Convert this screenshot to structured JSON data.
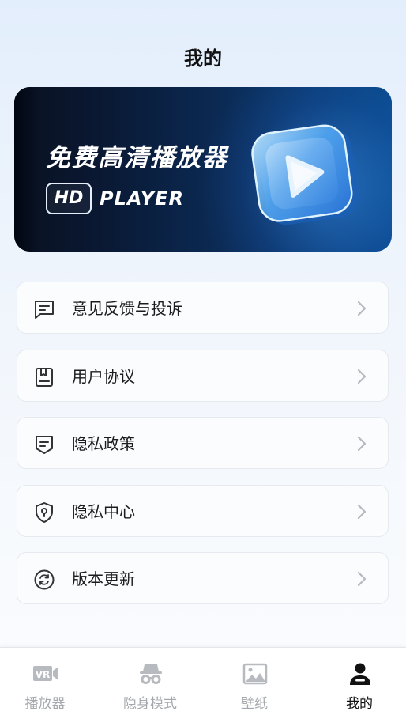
{
  "header": {
    "title": "我的"
  },
  "banner": {
    "headline": "免费高清播放器",
    "badge": "HD",
    "subtitle": "PLAYER"
  },
  "menu": {
    "items": [
      {
        "label": "意见反馈与投诉",
        "icon": "message-icon"
      },
      {
        "label": "用户协议",
        "icon": "bookmark-doc-icon"
      },
      {
        "label": "隐私政策",
        "icon": "doc-shield-icon"
      },
      {
        "label": "隐私中心",
        "icon": "shield-lock-icon"
      },
      {
        "label": "版本更新",
        "icon": "refresh-icon"
      }
    ]
  },
  "tabbar": {
    "tabs": [
      {
        "label": "播放器",
        "icon": "vr-camera-icon",
        "active": false
      },
      {
        "label": "隐身模式",
        "icon": "incognito-icon",
        "active": false
      },
      {
        "label": "壁纸",
        "icon": "image-icon",
        "active": false
      },
      {
        "label": "我的",
        "icon": "user-icon",
        "active": true
      }
    ]
  },
  "colors": {
    "active_tab": "#111111",
    "inactive_tab": "#a5a8ad",
    "chevron": "#b5bac2"
  }
}
